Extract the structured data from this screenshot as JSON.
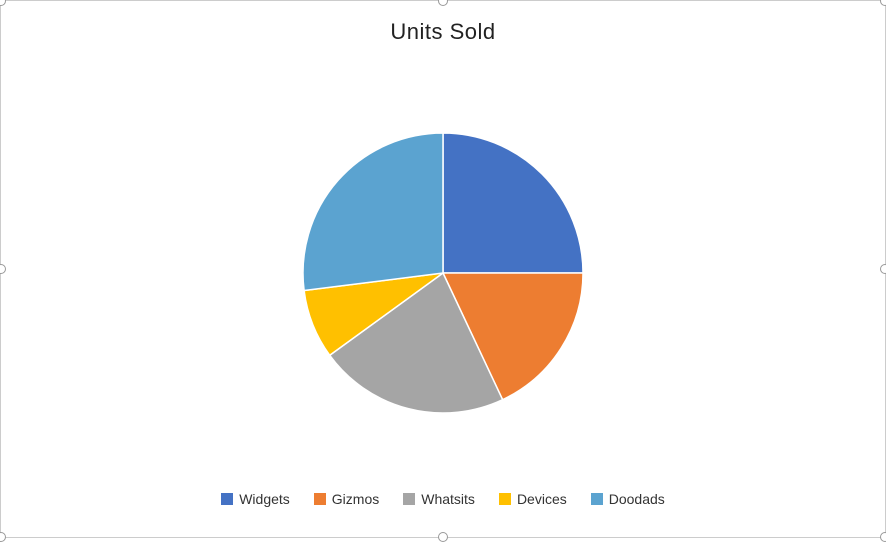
{
  "chart": {
    "title": "Units Sold",
    "segments": [
      {
        "name": "Widgets",
        "value": 25,
        "color": "#4472C4",
        "startAngle": -90,
        "sweepAngle": 90
      },
      {
        "name": "Gizmos",
        "value": 18,
        "color": "#ED7D31",
        "startAngle": 0,
        "sweepAngle": 65
      },
      {
        "name": "Whatsits",
        "value": 22,
        "color": "#A5A5A5",
        "startAngle": 65,
        "sweepAngle": 80
      },
      {
        "name": "Devices",
        "value": 8,
        "color": "#FFC000",
        "startAngle": 145,
        "sweepAngle": 30
      },
      {
        "name": "Doodads",
        "value": 27,
        "color": "#5BA3D0",
        "startAngle": 175,
        "sweepAngle": 95
      }
    ],
    "legend": {
      "items": [
        {
          "label": "Widgets",
          "color": "#4472C4"
        },
        {
          "label": "Gizmos",
          "color": "#ED7D31"
        },
        {
          "label": "Whatsits",
          "color": "#A5A5A5"
        },
        {
          "label": "Devices",
          "color": "#FFC000"
        },
        {
          "label": "Doodads",
          "color": "#5BA3D0"
        }
      ]
    }
  }
}
